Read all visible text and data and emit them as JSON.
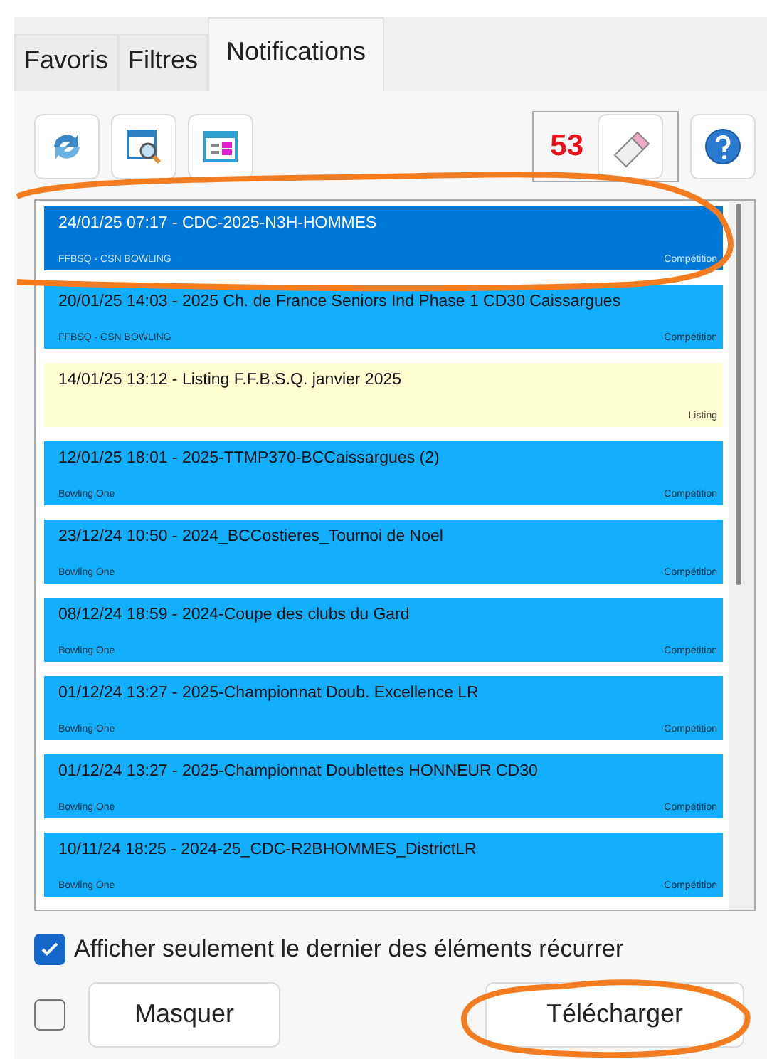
{
  "tabs": [
    {
      "label": "Favoris",
      "selected": false
    },
    {
      "label": "Filtres",
      "selected": false
    },
    {
      "label": "Notifications",
      "selected": true
    }
  ],
  "toolbar": {
    "counter": "53"
  },
  "notifications": [
    {
      "title": "24/01/25 07:17 - CDC-2025-N3H-HOMMES",
      "source": "FFBSQ - CSN BOWLING",
      "category": "Compétition",
      "selected": true,
      "color": "#0078d7"
    },
    {
      "title": "20/01/25 14:03 - 2025 Ch. de France Seniors  Ind Phase 1 CD30 Caissargues",
      "source": "FFBSQ - CSN BOWLING",
      "category": "Compétition",
      "selected": false,
      "color": "#13aefc"
    },
    {
      "title": "14/01/25 13:12 - Listing F.F.B.S.Q. janvier 2025",
      "category": "Listing",
      "selected": false,
      "color": "#ffffd2"
    },
    {
      "title": "12/01/25 18:01 - 2025-TTMP370-BCCaissargues (2)",
      "source": "Bowling One",
      "category": "Compétition",
      "selected": false,
      "color": "#13aefc"
    },
    {
      "title": "23/12/24 10:50 - 2024_BCCostieres_Tournoi de Noel",
      "source": "Bowling One",
      "category": "Compétition",
      "selected": false,
      "color": "#13aefc"
    },
    {
      "title": "08/12/24 18:59 - 2024-Coupe des clubs du Gard",
      "source": "Bowling One",
      "category": "Compétition",
      "selected": false,
      "color": "#13aefc"
    },
    {
      "title": "01/12/24 13:27 - 2025-Championnat Doub. Excellence LR",
      "source": "Bowling One",
      "category": "Compétition",
      "selected": false,
      "color": "#13aefc"
    },
    {
      "title": "01/12/24 13:27 - 2025-Championnat Doublettes HONNEUR CD30",
      "source": "Bowling One",
      "category": "Compétition",
      "selected": false,
      "color": "#13aefc"
    },
    {
      "title": "10/11/24 18:25 - 2024-25_CDC-R2BHOMMES_DistrictLR",
      "source": "Bowling One",
      "category": "Compétition",
      "selected": false,
      "color": "#13aefc"
    }
  ],
  "recurring_option": {
    "label": "Afficher seulement le dernier des éléments récurrer",
    "checked": true
  },
  "select_all": {
    "checked": false
  },
  "buttons": {
    "hide": "Masquer",
    "download": "Télécharger"
  }
}
